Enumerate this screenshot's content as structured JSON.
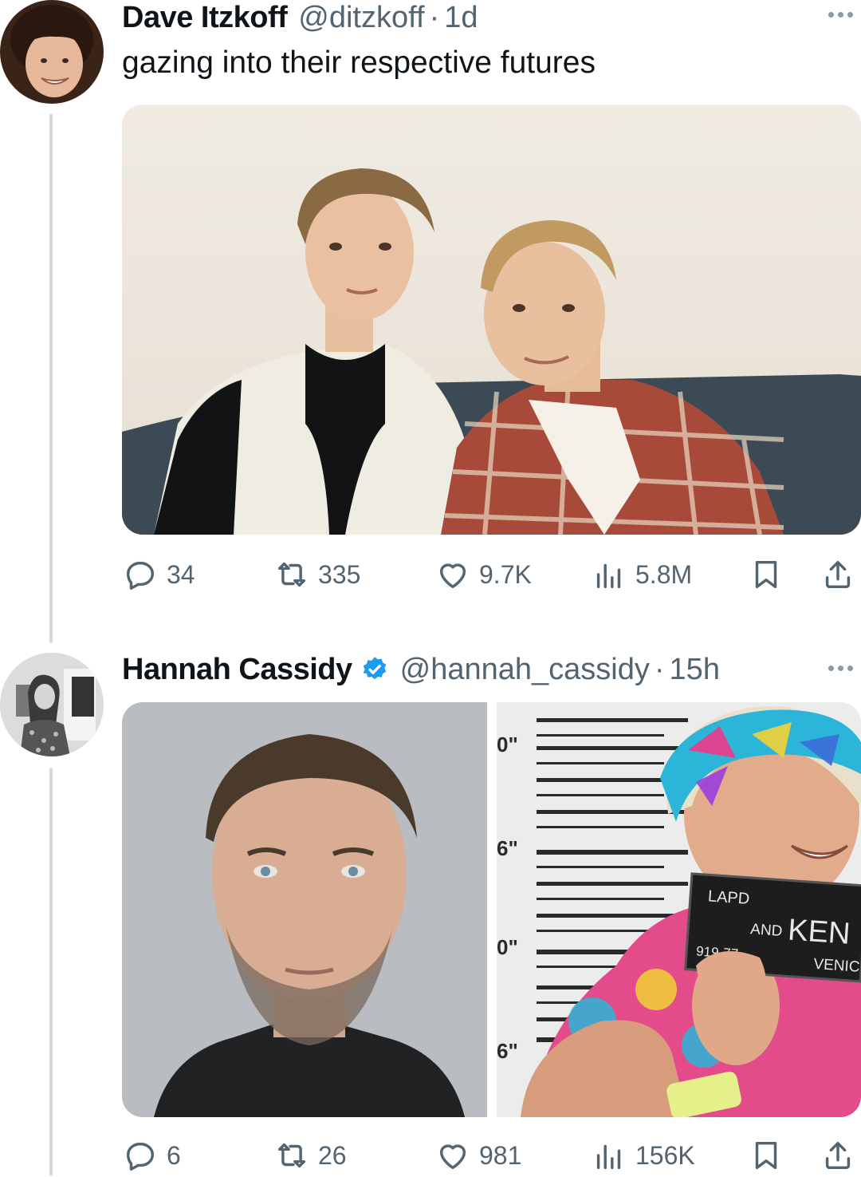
{
  "tweets": [
    {
      "author_name": "Dave Itzkoff",
      "handle": "@ditzkoff",
      "separator": "·",
      "time": "1d",
      "text": "gazing into their respective futures",
      "verified": false,
      "stats": {
        "replies": "34",
        "reposts": "335",
        "likes": "9.7K",
        "views": "5.8M"
      }
    },
    {
      "author_name": "Hannah Cassidy",
      "handle": "@hannah_cassidy",
      "separator": "·",
      "time": "15h",
      "text": "",
      "verified": true,
      "stats": {
        "replies": "6",
        "reposts": "26",
        "likes": "981",
        "views": "156K"
      },
      "media_sign": {
        "line1": "LAPD",
        "line2a": "AND",
        "line2b": "KEN",
        "line3a": "919-77",
        "line3b": "VENIC"
      },
      "height_marks": [
        "0\"",
        "6\"",
        "0\"",
        "6\""
      ]
    }
  ],
  "colors": {
    "text": "#0f1419",
    "secondary": "#536471",
    "verified": "#1d9bf0",
    "thread_line": "#cfd9de"
  },
  "icons": [
    "reply-icon",
    "repost-icon",
    "like-icon",
    "views-icon",
    "bookmark-icon",
    "share-icon",
    "more-icon",
    "verified-badge-icon"
  ]
}
